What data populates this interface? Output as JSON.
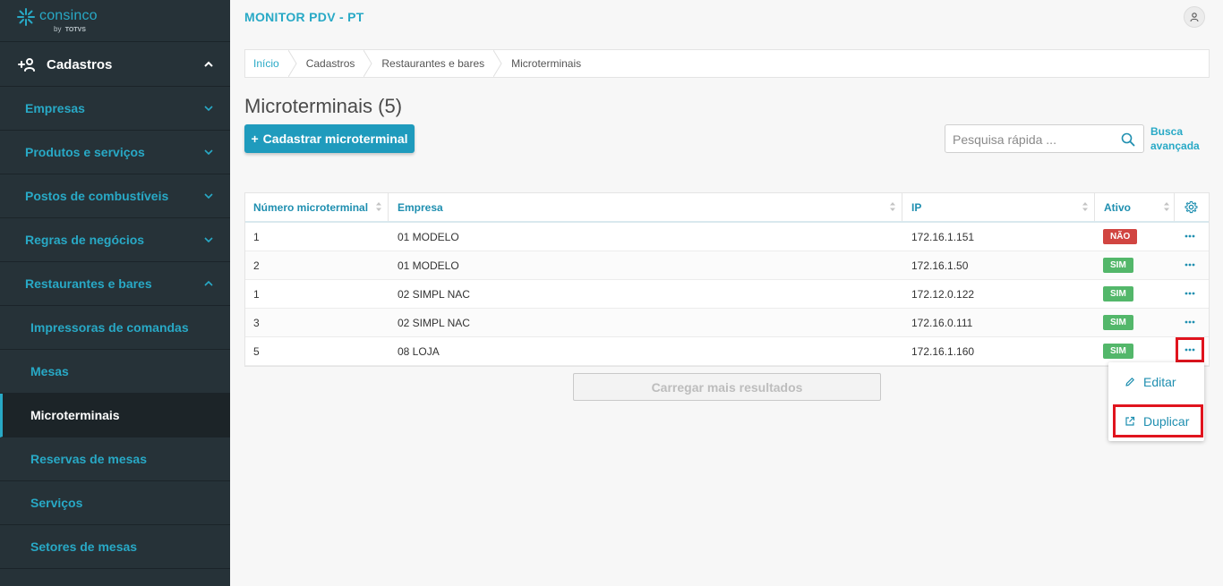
{
  "logo": {
    "name": "consinco",
    "by": "by",
    "brand": "TOTVS"
  },
  "sidebar": {
    "top": {
      "label": "Cadastros"
    },
    "sections": [
      {
        "label": "Empresas",
        "expanded": false
      },
      {
        "label": "Produtos e serviços",
        "expanded": false
      },
      {
        "label": "Postos de combustíveis",
        "expanded": false
      },
      {
        "label": "Regras de negócios",
        "expanded": false
      },
      {
        "label": "Restaurantes e bares",
        "expanded": true
      }
    ],
    "subitems": [
      {
        "label": "Impressoras de comandas"
      },
      {
        "label": "Mesas"
      },
      {
        "label": "Microterminais",
        "active": true
      },
      {
        "label": "Reservas de mesas"
      },
      {
        "label": "Serviços"
      },
      {
        "label": "Setores de mesas"
      }
    ]
  },
  "header": {
    "app_title": "MONITOR PDV - PT"
  },
  "breadcrumb": [
    "Início",
    "Cadastros",
    "Restaurantes e bares",
    "Microterminais"
  ],
  "page": {
    "title": "Microterminais (5)",
    "add_label": "Cadastrar microterminal",
    "search_placeholder": "Pesquisa rápida ...",
    "advanced_search": "Busca avançada"
  },
  "table": {
    "columns": [
      "Número microterminal",
      "Empresa",
      "IP",
      "Ativo"
    ],
    "rows": [
      {
        "numero": "1",
        "empresa": "01 MODELO",
        "ip": "172.16.1.151",
        "ativo": "NÃO"
      },
      {
        "numero": "2",
        "empresa": "01 MODELO",
        "ip": "172.16.1.50",
        "ativo": "SIM"
      },
      {
        "numero": "1",
        "empresa": "02 SIMPL NAC",
        "ip": "172.12.0.122",
        "ativo": "SIM"
      },
      {
        "numero": "3",
        "empresa": "02 SIMPL NAC",
        "ip": "172.16.0.111",
        "ativo": "SIM"
      },
      {
        "numero": "5",
        "empresa": "08 LOJA",
        "ip": "172.16.1.160",
        "ativo": "SIM"
      }
    ],
    "load_more": "Carregar mais resultados"
  },
  "context_menu": {
    "edit": "Editar",
    "duplicate": "Duplicar"
  },
  "colors": {
    "accent": "#28a9c6",
    "sidebar": "#263238",
    "primary_button": "#1f9bbd",
    "badge_no": "#d14541",
    "badge_yes": "#53b76a",
    "highlight": "#e0141e"
  },
  "icons": [
    "consinco-logo-icon",
    "add-user-icon",
    "chevron-up-icon",
    "chevron-down-icon",
    "user-icon",
    "search-icon",
    "sort-icon",
    "gear-icon",
    "more-icon",
    "pencil-icon",
    "external-link-icon"
  ]
}
